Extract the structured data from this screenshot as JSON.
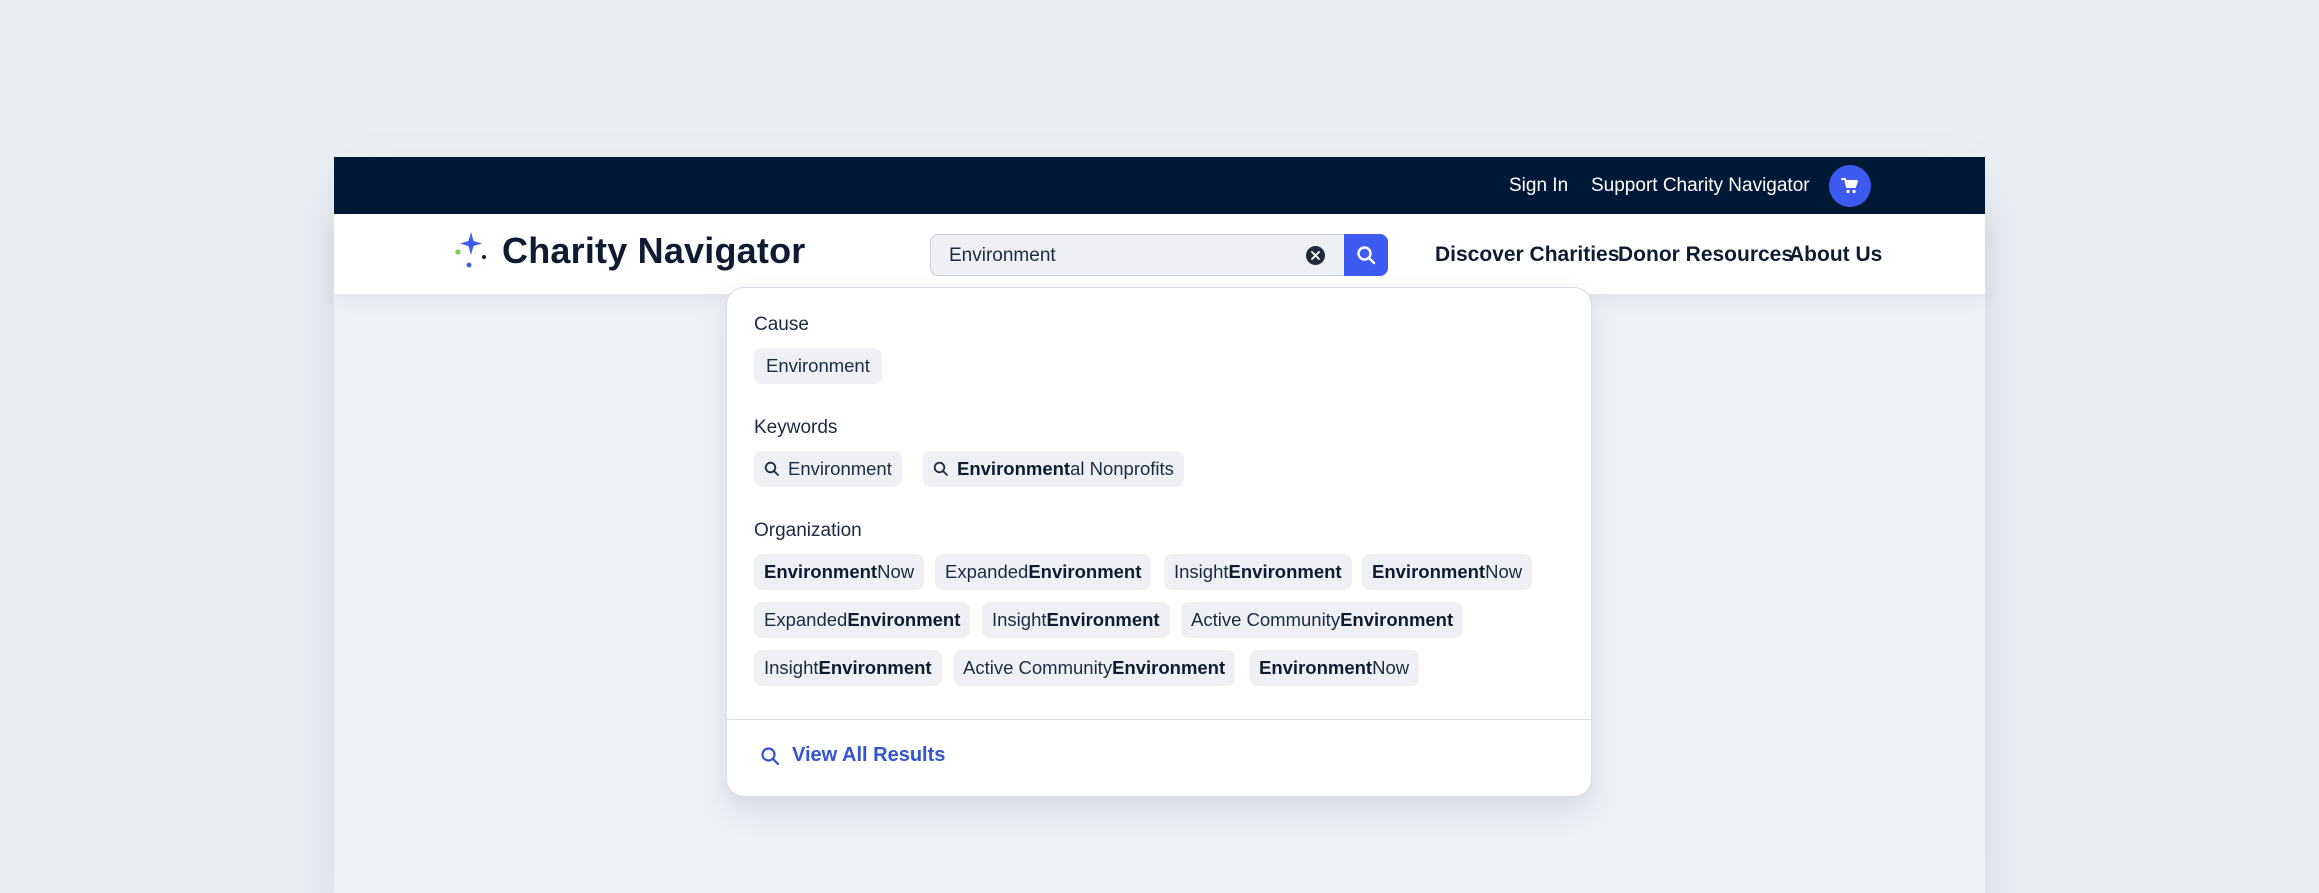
{
  "topbar": {
    "sign_in": "Sign In",
    "support": "Support Charity Navigator"
  },
  "brand": {
    "name": "Charity Navigator"
  },
  "search": {
    "value": "Environment"
  },
  "nav": {
    "discover": "Discover Charities",
    "donor": "Donor Resources",
    "about": "About Us"
  },
  "dropdown": {
    "cause_label": "Cause",
    "cause_items": [
      "Environment"
    ],
    "keywords_label": "Keywords",
    "keywords": [
      {
        "bold": "",
        "rest": "Environment"
      },
      {
        "bold": "Environment",
        "rest": "al Nonprofits"
      }
    ],
    "organization_label": "Organization",
    "organizations": [
      {
        "pre": "",
        "bold": "Environment",
        "post": " Now"
      },
      {
        "pre": "Expanded ",
        "bold": "Environment",
        "post": ""
      },
      {
        "pre": "Insight ",
        "bold": "Environment",
        "post": ""
      },
      {
        "pre": "",
        "bold": "Environment",
        "post": " Now"
      },
      {
        "pre": "Expanded ",
        "bold": "Environment",
        "post": ""
      },
      {
        "pre": "Insight ",
        "bold": "Environment",
        "post": ""
      },
      {
        "pre": "Active Community ",
        "bold": "Environment",
        "post": ""
      },
      {
        "pre": "Insight ",
        "bold": "Environment",
        "post": ""
      },
      {
        "pre": "Active Community ",
        "bold": "Environment",
        "post": ""
      },
      {
        "pre": "",
        "bold": "Environment",
        "post": " Now"
      }
    ],
    "view_all": "View All Results"
  },
  "colors": {
    "topbar_bg": "#001936",
    "accent": "#3d5af1",
    "link": "#3454d1",
    "chip_bg": "#eef0f4"
  }
}
